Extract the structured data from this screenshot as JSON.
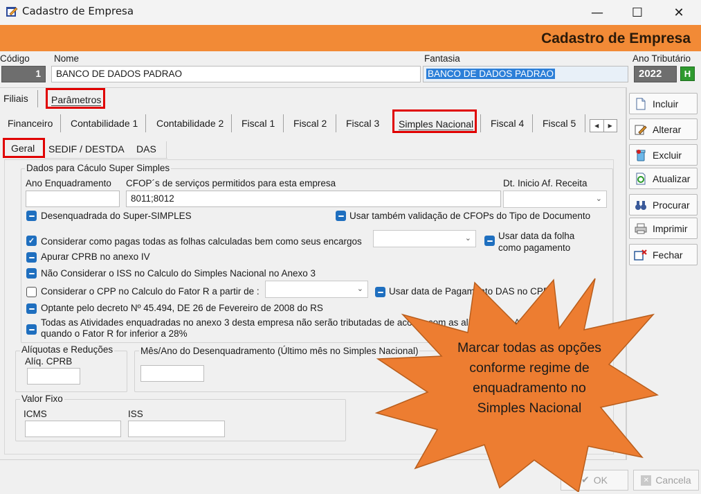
{
  "window": {
    "title": "Cadastro de Empresa",
    "minimize": "—",
    "maximize": "☐",
    "close": "✕"
  },
  "banner": {
    "title": "Cadastro de Empresa"
  },
  "header": {
    "codigo_label": "Código",
    "codigo_value": "1",
    "nome_label": "Nome",
    "nome_value": "BANCO DE DADOS PADRAO",
    "fantasia_label": "Fantasia",
    "fantasia_value": "BANCO DE DADOS PADRAO",
    "ano_label": "Ano Tributário",
    "ano_value": "2022",
    "ano_btn": "H"
  },
  "tabs_top": [
    "Filiais",
    "Parâmetros"
  ],
  "tabs_mid": [
    "Financeiro",
    "Contabilidade 1",
    "Contabilidade 2",
    "Fiscal 1",
    "Fiscal 2",
    "Fiscal 3",
    "Simples Nacional",
    "Fiscal 4",
    "Fiscal 5"
  ],
  "tabs_sub": [
    "Geral",
    "SEDIF / DESTDA",
    "DAS"
  ],
  "scroll_left": "◀",
  "scroll_right": "▶",
  "dados": {
    "caption": "Dados para Cáculo Super Simples",
    "ano_enq_label": "Ano Enquadramento",
    "cfop_label": "CFOP´s de serviços permitidos para esta empresa",
    "cfop_value": "8011;8012",
    "dt_label": "Dt. Inicio Af. Receita",
    "cb1": "Desenquadrada do Super-SIMPLES",
    "cb2": "Usar também validação de CFOPs do Tipo de Documento",
    "cb3": "Considerar como pagas todas as folhas calculadas bem como seus encargos",
    "cb4a": "Usar data da folha",
    "cb4b": "como pagamento",
    "cb5": "Apurar CPRB no anexo IV",
    "cb6": "Não Considerar o ISS no Calculo do Simples Nacional no Anexo 3",
    "cb7": "Considerar o CPP no Calculo do Fator R a partir de :",
    "cb8": "Usar data de Pagamento DAS no CPP",
    "cb9": "Optante pelo decreto  Nº 45.494, DE 26 de Fevereiro de 2008 do RS",
    "cb10a": "Todas as Atividades enquadradas no anexo 3 desta empresa não serão tributadas de acordo com as alíquotas do Anexo 5",
    "cb10b": "quando o Fator R for inferior a 28%"
  },
  "aliquotas": {
    "caption": "Alíquotas e Reduções",
    "cprb_label": "Alíq. CPRB"
  },
  "desenq_label": "Mês/Ano do Desenquadramento (Último mês no Simples Nacional)",
  "valor_fixo": {
    "caption": "Valor Fixo",
    "icms_label": "ICMS",
    "iss_label": "ISS"
  },
  "side_buttons": [
    "Incluir",
    "Alterar",
    "Excluir",
    "Atualizar",
    "Procurar",
    "Imprimir",
    "Fechar"
  ],
  "bottom": {
    "ok": "OK",
    "cancel": "Cancela"
  },
  "callout": {
    "text": "Marcar todas as opções conforme regime de enquadramento no Simples Nacional"
  },
  "colors": {
    "banner": "#f28a36",
    "callout": "#ed7d31",
    "highlight": "#e00000",
    "checkbox": "#1f6fbf"
  }
}
